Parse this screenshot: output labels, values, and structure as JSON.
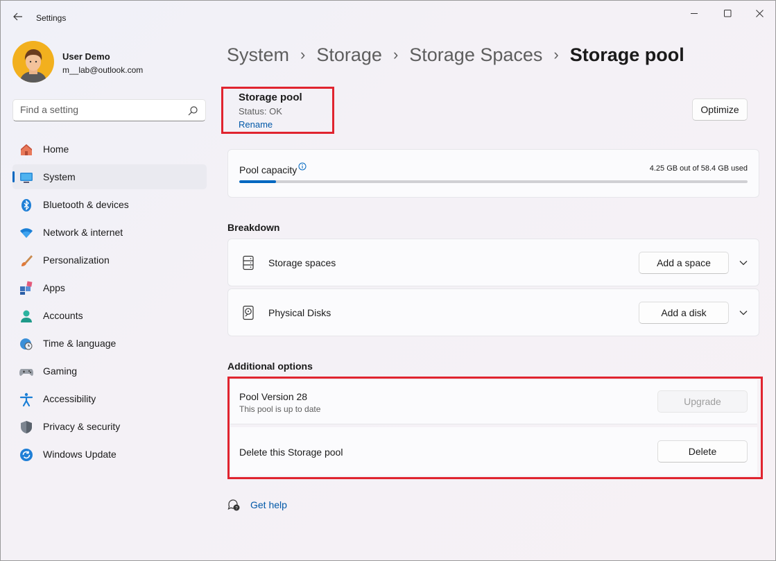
{
  "window": {
    "app_title": "Settings",
    "icons": {
      "back": "back-arrow-icon",
      "minimize": "minimize-icon",
      "maximize": "maximize-icon",
      "close": "close-icon"
    }
  },
  "profile": {
    "name": "User Demo",
    "email": "m__lab@outlook.com"
  },
  "search": {
    "placeholder": "Find a setting",
    "value": ""
  },
  "sidebar": {
    "items": [
      {
        "label": "Home",
        "icon": "home-icon",
        "active": false
      },
      {
        "label": "System",
        "icon": "system-monitor-icon",
        "active": true
      },
      {
        "label": "Bluetooth & devices",
        "icon": "bluetooth-icon",
        "active": false
      },
      {
        "label": "Network & internet",
        "icon": "wifi-icon",
        "active": false
      },
      {
        "label": "Personalization",
        "icon": "paintbrush-icon",
        "active": false
      },
      {
        "label": "Apps",
        "icon": "apps-icon",
        "active": false
      },
      {
        "label": "Accounts",
        "icon": "person-icon",
        "active": false
      },
      {
        "label": "Time & language",
        "icon": "globe-clock-icon",
        "active": false
      },
      {
        "label": "Gaming",
        "icon": "gamepad-icon",
        "active": false
      },
      {
        "label": "Accessibility",
        "icon": "accessibility-icon",
        "active": false
      },
      {
        "label": "Privacy & security",
        "icon": "shield-icon",
        "active": false
      },
      {
        "label": "Windows Update",
        "icon": "update-icon",
        "active": false
      }
    ]
  },
  "breadcrumb": [
    "System",
    "Storage",
    "Storage Spaces",
    "Storage pool"
  ],
  "pool": {
    "title": "Storage pool",
    "status": "Status: OK",
    "rename": "Rename",
    "optimize_label": "Optimize"
  },
  "capacity": {
    "label": "Pool capacity",
    "used_text": "4.25 GB out of 58.4 GB used",
    "used_fraction": 0.0728
  },
  "breakdown": {
    "title": "Breakdown",
    "storage_spaces": {
      "label": "Storage spaces",
      "button": "Add a space",
      "icon": "storage-spaces-icon"
    },
    "physical_disks": {
      "label": "Physical Disks",
      "button": "Add a disk",
      "icon": "hard-disk-icon"
    }
  },
  "additional": {
    "title": "Additional options",
    "version": {
      "label": "Pool Version 28",
      "sub": "This pool is up to date",
      "button": "Upgrade"
    },
    "delete": {
      "label": "Delete this Storage pool",
      "button": "Delete"
    }
  },
  "help": {
    "label": "Get help"
  },
  "colors": {
    "accent": "#0067c0",
    "highlight": "#e0242f",
    "link": "#0058a8"
  }
}
